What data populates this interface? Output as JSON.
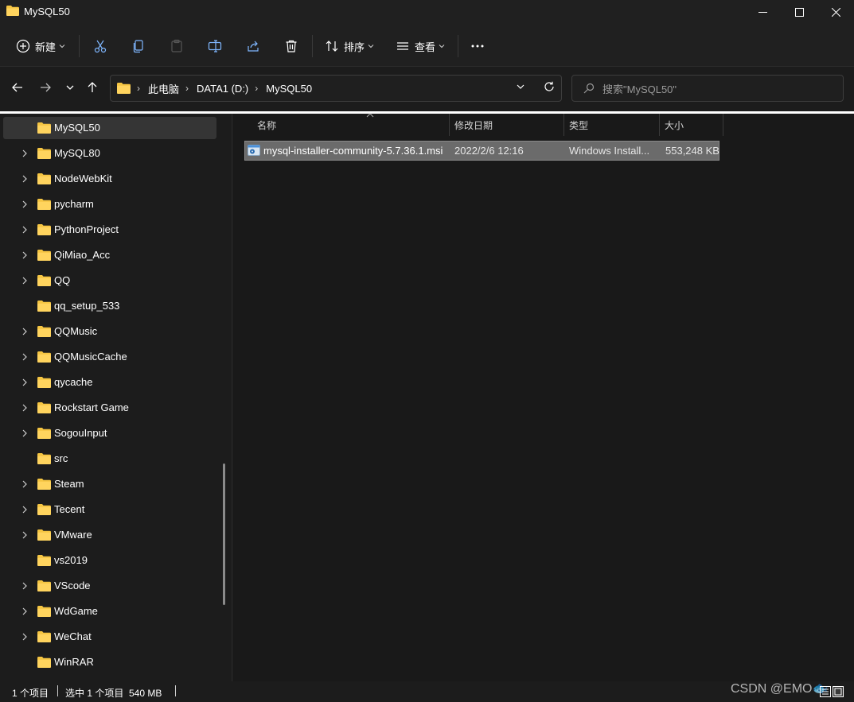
{
  "window": {
    "title": "MySQL50"
  },
  "toolbar": {
    "new_label": "新建",
    "sort_label": "排序",
    "view_label": "查看"
  },
  "address": {
    "crumbs": [
      "此电脑",
      "DATA1 (D:)",
      "MySQL50"
    ]
  },
  "search": {
    "placeholder": "搜索\"MySQL50\""
  },
  "sidebar": {
    "items": [
      {
        "label": "MySQL50",
        "expandable": false,
        "selected": true
      },
      {
        "label": "MySQL80",
        "expandable": true
      },
      {
        "label": "NodeWebKit",
        "expandable": true
      },
      {
        "label": "pycharm",
        "expandable": true
      },
      {
        "label": "PythonProject",
        "expandable": true
      },
      {
        "label": "QiMiao_Acc",
        "expandable": true
      },
      {
        "label": "QQ",
        "expandable": true
      },
      {
        "label": "qq_setup_533",
        "expandable": false
      },
      {
        "label": "QQMusic",
        "expandable": true
      },
      {
        "label": "QQMusicCache",
        "expandable": true
      },
      {
        "label": "qycache",
        "expandable": true
      },
      {
        "label": "Rockstart Game",
        "expandable": true
      },
      {
        "label": "SogouInput",
        "expandable": true
      },
      {
        "label": "src",
        "expandable": false
      },
      {
        "label": "Steam",
        "expandable": true
      },
      {
        "label": "Tecent",
        "expandable": true
      },
      {
        "label": "VMware",
        "expandable": true
      },
      {
        "label": "vs2019",
        "expandable": false
      },
      {
        "label": "VScode",
        "expandable": true
      },
      {
        "label": "WdGame",
        "expandable": true
      },
      {
        "label": "WeChat",
        "expandable": true
      },
      {
        "label": "WinRAR",
        "expandable": false
      }
    ]
  },
  "filelist": {
    "columns": [
      "名称",
      "修改日期",
      "类型",
      "大小"
    ],
    "rows": [
      {
        "name": "mysql-installer-community-5.7.36.1.msi",
        "modified": "2022/2/6 12:16",
        "type": "Windows Install...",
        "size": "553,248 KB"
      }
    ]
  },
  "status": {
    "count": "1 个项目",
    "selection": "选中 1 个项目  540 MB"
  },
  "watermark": "CSDN @EMO🐟",
  "colors": {
    "folder": "#f5c542",
    "selection": "#6b6b6b",
    "background": "#1c1c1c"
  }
}
